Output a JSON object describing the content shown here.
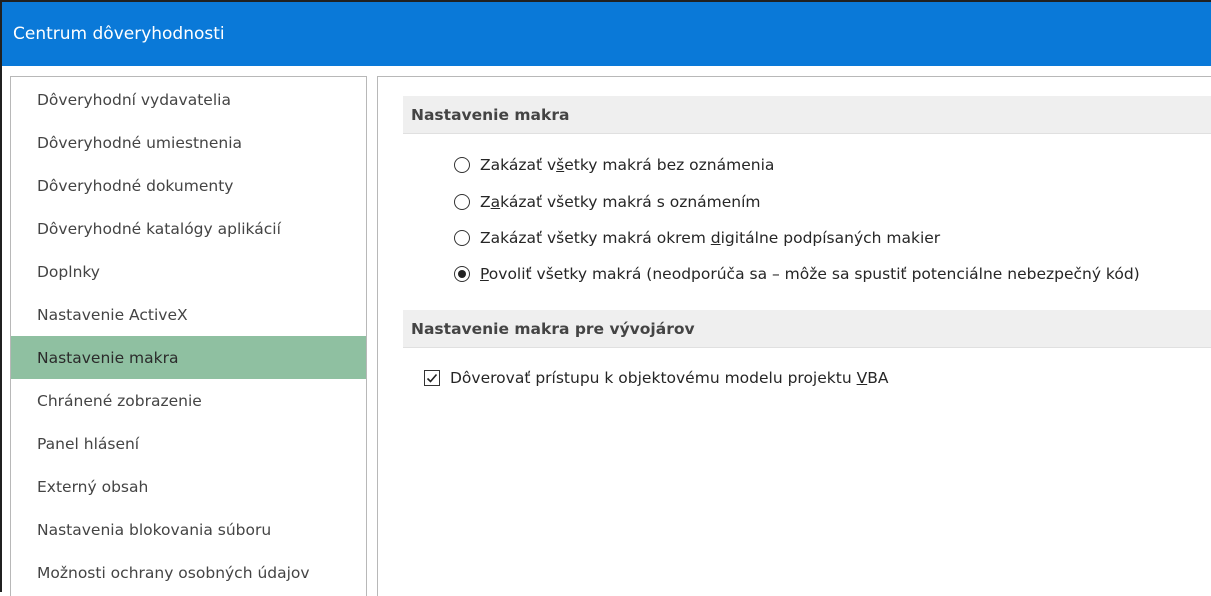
{
  "window": {
    "title": "Centrum dôveryhodnosti"
  },
  "sidebar": {
    "items": [
      {
        "label": "Dôveryhodní vydavatelia",
        "selected": false
      },
      {
        "label": "Dôveryhodné umiestnenia",
        "selected": false
      },
      {
        "label": "Dôveryhodné dokumenty",
        "selected": false
      },
      {
        "label": "Dôveryhodné katalógy aplikácií",
        "selected": false
      },
      {
        "label": "Doplnky",
        "selected": false
      },
      {
        "label": "Nastavenie ActiveX",
        "selected": false
      },
      {
        "label": "Nastavenie makra",
        "selected": true
      },
      {
        "label": "Chránené zobrazenie",
        "selected": false
      },
      {
        "label": "Panel hlásení",
        "selected": false
      },
      {
        "label": "Externý obsah",
        "selected": false
      },
      {
        "label": "Nastavenia blokovania súboru",
        "selected": false
      },
      {
        "label": "Možnosti ochrany osobných údajov",
        "selected": false
      }
    ]
  },
  "macro_settings": {
    "header": "Nastavenie makra",
    "options": [
      {
        "pre": "Zakázať v",
        "key": "š",
        "post": "etky makrá bez oznámenia",
        "checked": false
      },
      {
        "pre": "Z",
        "key": "a",
        "post": "kázať všetky makrá s oznámením",
        "checked": false
      },
      {
        "pre": "Zakázať všetky makrá okrem ",
        "key": "d",
        "post": "igitálne podpísaných makier",
        "checked": false
      },
      {
        "pre": "",
        "key": "P",
        "post": "ovoliť všetky makrá (neodporúča sa – môže sa spustiť potenciálne nebezpečný kód)",
        "checked": true
      }
    ]
  },
  "developer_settings": {
    "header": "Nastavenie makra pre vývojárov",
    "vba_access": {
      "pre": "Dôverovať prístupu k objektovému modelu projektu ",
      "key": "V",
      "post": "BA",
      "checked": true
    }
  },
  "colors": {
    "titlebar": "#0a79d8",
    "selected_item": "#8fc0a1",
    "section_header": "#efefef"
  }
}
